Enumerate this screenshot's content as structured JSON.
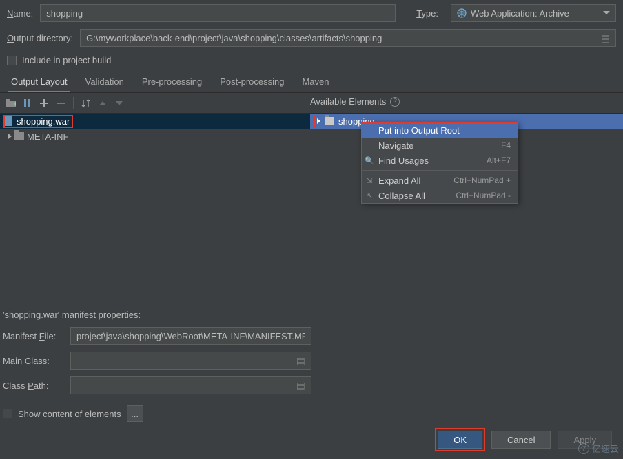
{
  "fields": {
    "name_label": "Name:",
    "name_value": "shopping",
    "type_label": "Type:",
    "type_value": "Web Application: Archive",
    "output_dir_label": "Output directory:",
    "output_dir_value": "G:\\myworkplace\\back-end\\project\\java\\shopping\\classes\\artifacts\\shopping",
    "include_build": "Include in project build"
  },
  "tabs": {
    "t0": "Output Layout",
    "t1": "Validation",
    "t2": "Pre-processing",
    "t3": "Post-processing",
    "t4": "Maven"
  },
  "available_header": "Available Elements",
  "tree": {
    "left_root": "shopping.war",
    "left_child": "META-INF",
    "right_root": "shopping"
  },
  "context_menu": {
    "m0": "Put into Output Root",
    "m1": "Navigate",
    "m1_key": "F4",
    "m2": "Find Usages",
    "m2_key": "Alt+F7",
    "m3": "Expand All",
    "m3_key": "Ctrl+NumPad +",
    "m4": "Collapse All",
    "m4_key": "Ctrl+NumPad -"
  },
  "properties": {
    "title": "'shopping.war' manifest properties:",
    "manifest_label": "Manifest File:",
    "manifest_value": "project\\java\\shopping\\WebRoot\\META-INF\\MANIFEST.MF",
    "main_class_label": "Main Class:",
    "class_path_label": "Class Path:",
    "show_content": "Show content of elements",
    "ellipsis": "..."
  },
  "buttons": {
    "ok": "OK",
    "cancel": "Cancel",
    "apply": "Apply"
  },
  "watermark": "亿速云"
}
